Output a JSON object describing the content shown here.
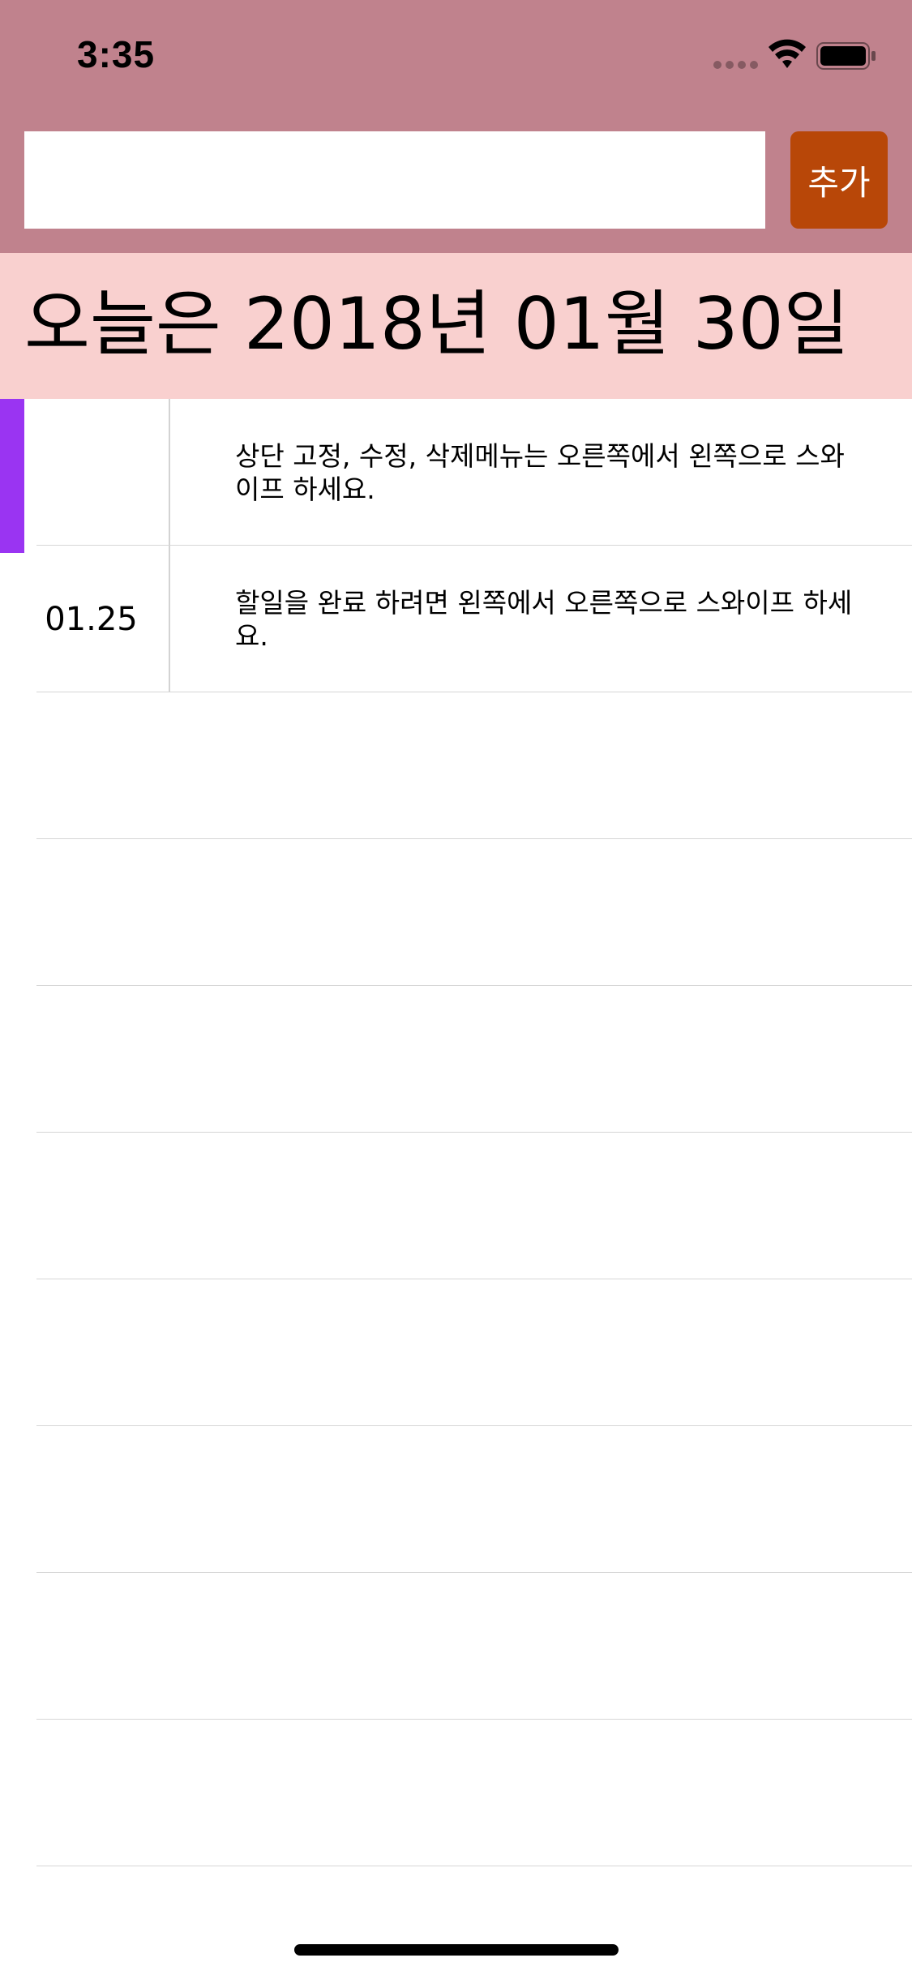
{
  "status_bar": {
    "time": "3:35"
  },
  "input": {
    "value": "",
    "placeholder": ""
  },
  "add_button": {
    "label": "추가"
  },
  "date_banner": {
    "title": "오늘은 2018년 01월 30일"
  },
  "todos": [
    {
      "date": "",
      "text": "상단 고정, 수정, 삭제메뉴는 오른쪽에서 왼쪽으로 스와이프 하세요.",
      "pinned": true
    },
    {
      "date": "01.25",
      "text": "할일을 완료 하려면 왼쪽에서 오른쪽으로 스와이프 하세요.",
      "pinned": false
    }
  ],
  "colors": {
    "header_bg": "#c0828d",
    "add_button_bg": "#b84708",
    "date_banner_bg": "#f9d0cf",
    "pin_marker": "#9a34f2"
  },
  "icons": [
    "cellular-dots-icon",
    "wifi-icon",
    "battery-icon"
  ]
}
